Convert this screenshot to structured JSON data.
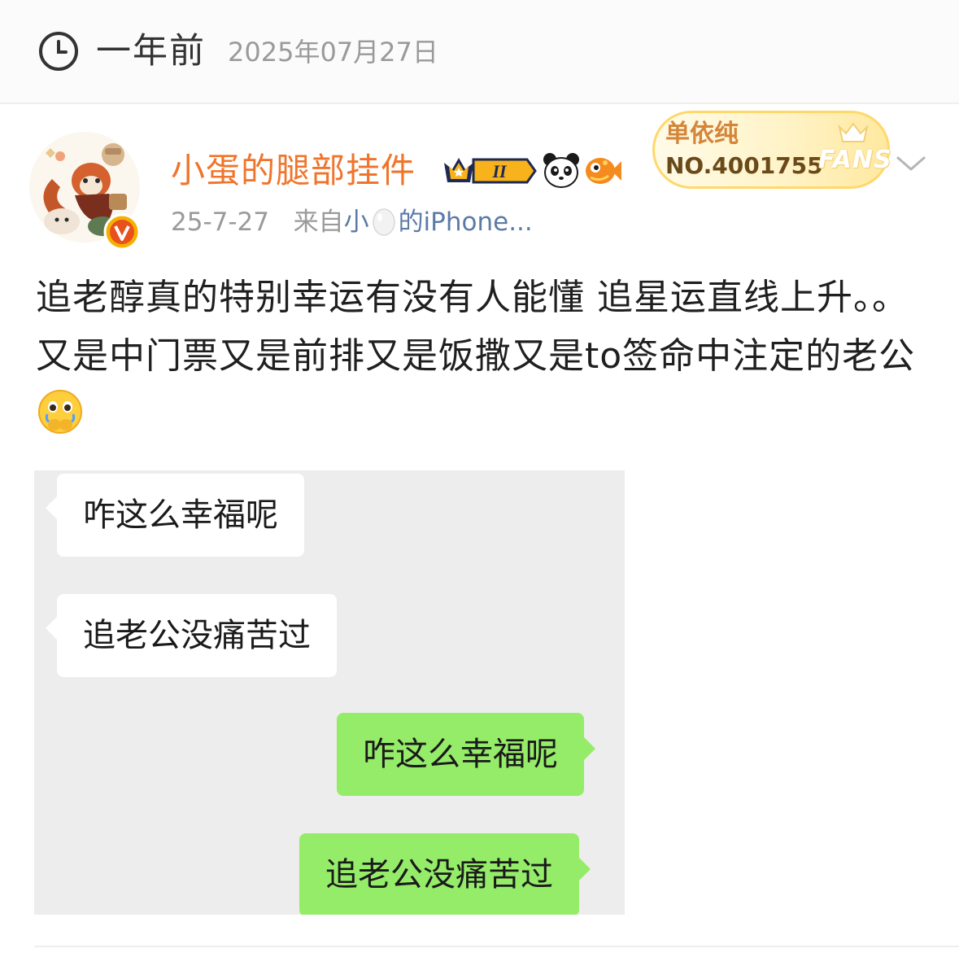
{
  "memory": {
    "relative_time": "一年前",
    "date": "2025年07月27日"
  },
  "author": {
    "name": "小蛋的腿部挂件",
    "level_badge": "II",
    "name_color": "#f0752c"
  },
  "meta": {
    "date": "25-7-27",
    "from_prefix": "来自",
    "source_a": "小",
    "source_b": "的iPhone..."
  },
  "fans": {
    "group": "单依纯",
    "number": "NO.4001755",
    "label": "FANS"
  },
  "post": {
    "text": "追老醇真的特别幸运有没有人能懂 追星运直线上升。。又是中门票又是前排又是饭撒又是to签命中注定的老公",
    "emoji": "crying-face-emoji"
  },
  "chat": {
    "messages": [
      {
        "side": "left",
        "text": "咋这么幸福呢"
      },
      {
        "side": "left",
        "text": "追老公没痛苦过"
      },
      {
        "side": "right",
        "text": "咋这么幸福呢"
      },
      {
        "side": "right",
        "text": "追老公没痛苦过"
      }
    ],
    "background": "#ededed",
    "right_bubble_color": "#95ec69"
  }
}
